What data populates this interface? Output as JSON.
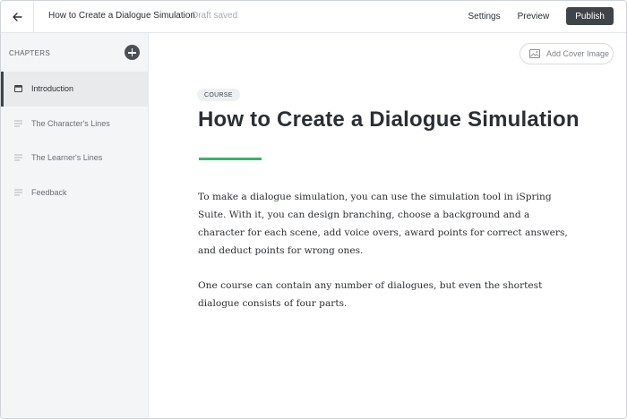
{
  "header": {
    "title": "How to Create a Dialogue Simulation",
    "status": "Draft saved",
    "settings_label": "Settings",
    "preview_label": "Preview",
    "publish_label": "Publish"
  },
  "sidebar": {
    "heading": "CHAPTERS",
    "items": [
      {
        "label": "Introduction",
        "active": true
      },
      {
        "label": "The Character's Lines",
        "active": false
      },
      {
        "label": "The Learner's Lines",
        "active": false
      },
      {
        "label": "Feedback",
        "active": false
      }
    ]
  },
  "main": {
    "cover_button_label": "Add Cover Image",
    "badge": "COURSE",
    "title": "How to Create a Dialogue Simulation",
    "paragraphs": [
      "To make a dialogue simulation, you can use the simulation tool in iSpring Suite. With it, you can design branching, choose a background and a character for each scene, add voice overs, award points for correct answers, and deduct points for wrong ones.",
      "One course can contain any number of dialogues, but even the shortest dialogue consists of four parts."
    ]
  },
  "colors": {
    "accent_green": "#3ab26c",
    "publish_bg": "#3f4449",
    "sidebar_bg": "#f4f5f6"
  },
  "icons": {
    "back": "arrow-left-icon",
    "add_chapter": "plus-circle-icon",
    "active_chapter": "chapter-page-icon",
    "chapter": "text-lines-icon",
    "cover": "image-icon"
  }
}
